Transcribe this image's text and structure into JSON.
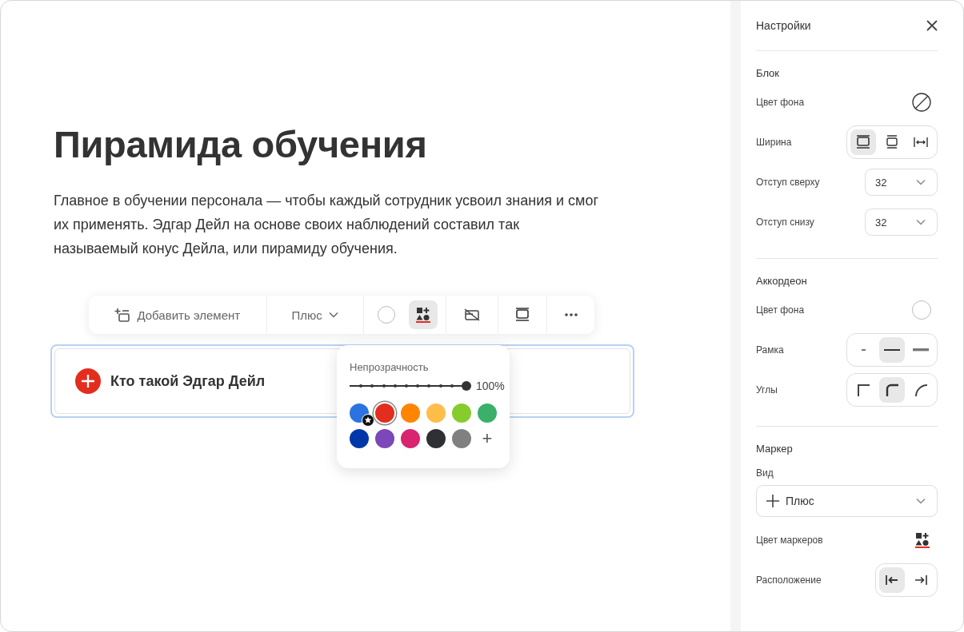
{
  "title": "Пирамида обучения",
  "paragraph": "Главное в обучении персонала — чтобы каждый сотрудник усвоил знания и смог их применять. Эдгар Дейл на основе своих наблюдений составил так называемый конус Дейла, или пирамиду обучения.",
  "toolbar": [
    {
      "kind": "add",
      "label": "Добавить элемент",
      "active": false
    },
    {
      "kind": "select",
      "label": "Плюс",
      "active": false
    },
    {
      "kind": "bg_color",
      "active": false
    },
    {
      "kind": "marker_color",
      "active": true
    },
    {
      "kind": "hide_border",
      "active": false
    },
    {
      "kind": "width",
      "active": false
    },
    {
      "kind": "more",
      "active": false
    }
  ],
  "accordion": {
    "title": "Кто такой Эдгар Дейл",
    "focused": true
  },
  "popover": {
    "label": "Непрозрачность",
    "level": 1,
    "reading": "100%",
    "add": "+",
    "swatches": [
      {
        "color": "#2a73e0",
        "selected": false,
        "default": true
      },
      {
        "color": "#e32d1e",
        "selected": true,
        "default": false
      },
      {
        "color": "#ff8500",
        "selected": false,
        "default": false
      },
      {
        "color": "#ffbd4a",
        "selected": false,
        "default": false
      },
      {
        "color": "#86cc2c",
        "selected": false,
        "default": false
      },
      {
        "color": "#3bb06a",
        "selected": false,
        "default": false
      },
      {
        "color": "#0037a8",
        "selected": false,
        "default": false
      },
      {
        "color": "#7c47b8",
        "selected": false,
        "default": false
      },
      {
        "color": "#d9246f",
        "selected": false,
        "default": false
      },
      {
        "color": "#2e3033",
        "selected": false,
        "default": false
      },
      {
        "color": "#808080",
        "selected": false,
        "default": false
      }
    ]
  },
  "sidebar": {
    "title": "Настройки",
    "sections": [
      {
        "title": "Блок",
        "rows": [
          {
            "kind": "color",
            "label": "Цвет фона",
            "transparent": true
          },
          {
            "kind": "segmented",
            "label": "Ширина",
            "options": [
              {
                "kind": "width_full",
                "selected": true
              },
              {
                "kind": "width_medium",
                "selected": false
              },
              {
                "kind": "width_stretch",
                "selected": false
              }
            ]
          },
          {
            "kind": "select",
            "label": "Отступ сверху",
            "value": "32"
          },
          {
            "kind": "select",
            "label": "Отступ снизу",
            "value": "32"
          }
        ]
      },
      {
        "title": "Аккордеон",
        "rows": [
          {
            "kind": "color",
            "label": "Цвет фона",
            "transparent": false
          },
          {
            "kind": "segmented",
            "label": "Рамка",
            "options": [
              {
                "kind": "border_thin",
                "selected": false
              },
              {
                "kind": "border_medium",
                "selected": true
              },
              {
                "kind": "border_thick",
                "selected": false
              }
            ]
          },
          {
            "kind": "segmented",
            "label": "Углы",
            "options": [
              {
                "kind": "corner_square",
                "selected": false
              },
              {
                "kind": "corner_rounded",
                "selected": true
              },
              {
                "kind": "corner_round",
                "selected": false
              }
            ]
          }
        ]
      },
      {
        "title": "Маркер",
        "rows": [
          {
            "kind": "wide_select",
            "label": "Вид",
            "value": "Плюс"
          },
          {
            "kind": "marker_color",
            "label": "Цвет маркеров"
          },
          {
            "kind": "segmented",
            "label": "Расположение",
            "options": [
              {
                "kind": "pos_left",
                "selected": true
              },
              {
                "kind": "pos_right",
                "selected": false
              }
            ]
          }
        ]
      }
    ]
  }
}
